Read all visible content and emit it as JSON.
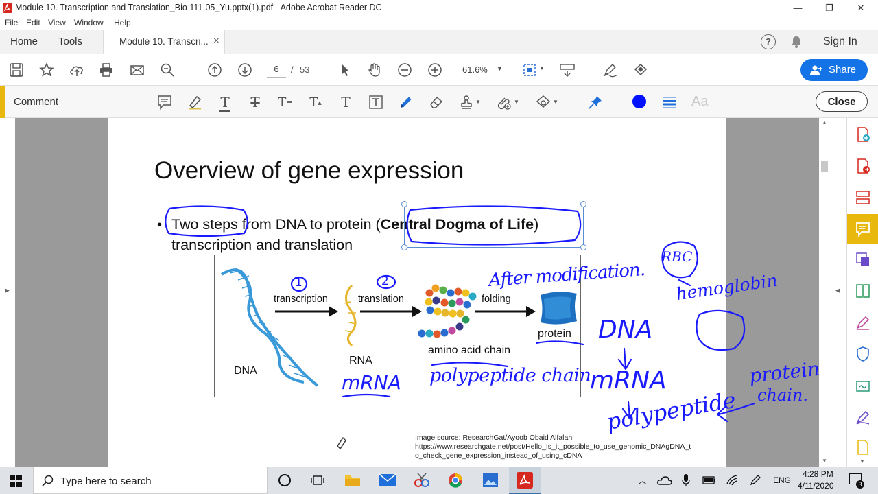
{
  "window": {
    "title": "Module 10. Transcription and Translation_Bio 111-05_Yu.pptx(1).pdf - Adobe Acrobat Reader DC",
    "minimize": "—",
    "maximize": "❐",
    "close": "✕"
  },
  "menu": [
    "File",
    "Edit",
    "View",
    "Window",
    "Help"
  ],
  "tabs": {
    "home": "Home",
    "tools": "Tools",
    "document": "Module 10. Transcri...",
    "document_close": "×",
    "sign_in": "Sign In"
  },
  "toolbar": {
    "page_current": "6",
    "page_separator": "/",
    "page_total": "53",
    "zoom": "61.6%",
    "share_label": "Share"
  },
  "comment_bar": {
    "title": "Comment",
    "close_label": "Close",
    "text_size_glyph": "Aa",
    "colors": {
      "accent": "#e8b80f",
      "ink": "#1a1aff",
      "share": "#1473e6"
    }
  },
  "slide": {
    "title": "Overview of gene expression",
    "bullet": "•",
    "line1_a": "Two steps",
    "line1_b": " from DNA to protein (",
    "line1_c": "Central Dogma of Life",
    "line1_d": ")",
    "line2": "transcription and translation",
    "figure": {
      "step1": "transcription",
      "step2": "translation",
      "step3": "folding",
      "dna": "DNA",
      "rna": "RNA",
      "amino": "amino acid chain",
      "protein": "protein"
    },
    "source_line1": "Image source: ResearchGat/Ayoob Obaid Alfalahi",
    "source_line2": "https://www.researchgate.net/post/Hello_Is_it_possible_to_use_genomic_DNAgDNA_t",
    "source_line3": "o_check_gene_expression_instead_of_using_cDNA"
  },
  "handwriting": {
    "n1": "1",
    "n2": "2",
    "after_mod": "After modification.",
    "rbc": "RBC",
    "hemoglobin": "hemoglobin",
    "dna": "DNA",
    "mrna_flow": "mRNA",
    "polypeptide": "polypeptide",
    "protein_chain": "protein",
    "chain": "chain.",
    "mrna_under": "mRNA",
    "polypeptide_chain": "polypeptide chain",
    "arrow": "↓"
  },
  "taskbar": {
    "search_placeholder": "Type here to search",
    "language": "ENG",
    "time": "4:28 PM",
    "date": "4/11/2020",
    "notification_count": "3"
  }
}
